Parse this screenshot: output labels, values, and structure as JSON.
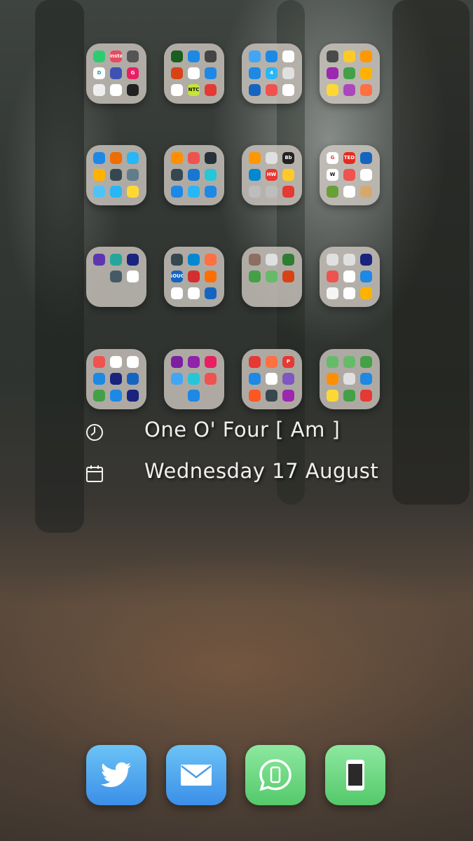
{
  "widgets": {
    "time_text": "One O' Four [ Am ]",
    "date_text": "Wednesday 17 August",
    "time_icon": "clock-icon",
    "date_icon": "calendar-icon"
  },
  "folders": [
    {
      "name": "folder-1",
      "apps": [
        {
          "label": "",
          "color": "#2ecc71"
        },
        {
          "label": "insta",
          "color": "#e84a5f"
        },
        {
          "label": "",
          "color": "#555555"
        },
        {
          "label": "D",
          "color": "#ffffff",
          "text": "#16a085"
        },
        {
          "label": "",
          "color": "#3f51b5"
        },
        {
          "label": "G",
          "color": "#e91e63"
        },
        {
          "label": "",
          "color": "#eeeeee"
        },
        {
          "label": "",
          "color": "#ffffff"
        },
        {
          "label": "",
          "color": "#222222"
        }
      ]
    },
    {
      "name": "folder-2",
      "apps": [
        {
          "label": "",
          "color": "#1b5e20"
        },
        {
          "label": "",
          "color": "#1e88e5"
        },
        {
          "label": "",
          "color": "#444444"
        },
        {
          "label": "",
          "color": "#d84315"
        },
        {
          "label": "",
          "color": "#ffffff"
        },
        {
          "label": "",
          "color": "#1e88e5"
        },
        {
          "label": "",
          "color": "#ffffff"
        },
        {
          "label": "NTC",
          "color": "#c6e43a",
          "text": "#111111"
        },
        {
          "label": "",
          "color": "#e53935"
        }
      ]
    },
    {
      "name": "folder-3",
      "apps": [
        {
          "label": "",
          "color": "#42a5f5"
        },
        {
          "label": "",
          "color": "#1e88e5"
        },
        {
          "label": "",
          "color": "#ffffff"
        },
        {
          "label": "",
          "color": "#1e88e5"
        },
        {
          "label": "4",
          "color": "#29b6f6"
        },
        {
          "label": "",
          "color": "#e0e0e0"
        },
        {
          "label": "",
          "color": "#1565c0"
        },
        {
          "label": "",
          "color": "#ef5350"
        },
        {
          "label": "",
          "color": "#ffffff"
        }
      ]
    },
    {
      "name": "folder-4",
      "apps": [
        {
          "label": "",
          "color": "#4a4a4a"
        },
        {
          "label": "",
          "color": "#ffca28"
        },
        {
          "label": "",
          "color": "#ff9800"
        },
        {
          "label": "",
          "color": "#9c27b0"
        },
        {
          "label": "",
          "color": "#43a047"
        },
        {
          "label": "",
          "color": "#ffb300"
        },
        {
          "label": "",
          "color": "#fdd835"
        },
        {
          "label": "",
          "color": "#ab47bc"
        },
        {
          "label": "",
          "color": "#ff7043"
        }
      ]
    },
    {
      "name": "folder-5",
      "apps": [
        {
          "label": "",
          "color": "#1e88e5"
        },
        {
          "label": "",
          "color": "#ef6c00"
        },
        {
          "label": "",
          "color": "#29b6f6"
        },
        {
          "label": "",
          "color": "#ffb300"
        },
        {
          "label": "",
          "color": "#37474f"
        },
        {
          "label": "",
          "color": "#607d8b"
        },
        {
          "label": "",
          "color": "#4fc3f7"
        },
        {
          "label": "",
          "color": "#29b6f6"
        },
        {
          "label": "",
          "color": "#fdd835"
        }
      ]
    },
    {
      "name": "folder-6",
      "apps": [
        {
          "label": "",
          "color": "#ff8f00"
        },
        {
          "label": "",
          "color": "#ef5350"
        },
        {
          "label": "",
          "color": "#263238"
        },
        {
          "label": "",
          "color": "#37474f"
        },
        {
          "label": "",
          "color": "#1976d2"
        },
        {
          "label": "",
          "color": "#26c6da"
        },
        {
          "label": "",
          "color": "#1e88e5"
        },
        {
          "label": "",
          "color": "#29b6f6"
        },
        {
          "label": "",
          "color": "#1e88e5"
        }
      ]
    },
    {
      "name": "folder-7",
      "apps": [
        {
          "label": "",
          "color": "#ff9800"
        },
        {
          "label": "",
          "color": "#e0e0e0"
        },
        {
          "label": "Bb",
          "color": "#222222"
        },
        {
          "label": "",
          "color": "#0288d1"
        },
        {
          "label": "HW",
          "color": "#e53935"
        },
        {
          "label": "",
          "color": "#ffca28"
        },
        {
          "label": "",
          "color": "#bdbdbd"
        },
        {
          "label": "",
          "color": "#bdbdbd"
        },
        {
          "label": "",
          "color": "#e53935"
        }
      ]
    },
    {
      "name": "folder-8",
      "apps": [
        {
          "label": "G",
          "color": "#ffffff",
          "text": "#e53935"
        },
        {
          "label": "TED",
          "color": "#e62b1e"
        },
        {
          "label": "",
          "color": "#1565c0"
        },
        {
          "label": "W",
          "color": "#ffffff",
          "text": "#111111"
        },
        {
          "label": "",
          "color": "#ef5350"
        },
        {
          "label": "",
          "color": "#ffffff"
        },
        {
          "label": "",
          "color": "#689f38"
        },
        {
          "label": "",
          "color": "#ffffff"
        },
        {
          "label": "",
          "color": "#d7a86e"
        }
      ]
    },
    {
      "name": "folder-9",
      "apps": [
        {
          "label": "",
          "color": "#5e35b1"
        },
        {
          "label": "",
          "color": "#26a69a"
        },
        {
          "label": "",
          "color": "#1a237e"
        },
        {
          "label": "",
          "color": "rgba(0,0,0,0)"
        },
        {
          "label": "",
          "color": "#455a64"
        },
        {
          "label": "",
          "color": "#ffffff"
        },
        {
          "label": "",
          "color": "rgba(0,0,0,0)"
        },
        {
          "label": "",
          "color": "rgba(0,0,0,0)"
        },
        {
          "label": "",
          "color": "rgba(0,0,0,0)"
        }
      ]
    },
    {
      "name": "folder-10",
      "apps": [
        {
          "label": "",
          "color": "#37474f"
        },
        {
          "label": "",
          "color": "#0288d1"
        },
        {
          "label": "",
          "color": "#ff7043"
        },
        {
          "label": "SOUQ",
          "color": "#1565c0"
        },
        {
          "label": "",
          "color": "#d32f2f"
        },
        {
          "label": "",
          "color": "#ff6f00"
        },
        {
          "label": "",
          "color": "#ffffff"
        },
        {
          "label": "",
          "color": "#ffffff"
        },
        {
          "label": "",
          "color": "#1565c0"
        }
      ]
    },
    {
      "name": "folder-11",
      "apps": [
        {
          "label": "",
          "color": "#8d6e63"
        },
        {
          "label": "",
          "color": "#e0e0e0"
        },
        {
          "label": "",
          "color": "#2e7d32"
        },
        {
          "label": "",
          "color": "#43a047"
        },
        {
          "label": "",
          "color": "#66bb6a"
        },
        {
          "label": "",
          "color": "#d84315"
        },
        {
          "label": "",
          "color": "rgba(0,0,0,0)"
        },
        {
          "label": "",
          "color": "rgba(0,0,0,0)"
        },
        {
          "label": "",
          "color": "rgba(0,0,0,0)"
        }
      ]
    },
    {
      "name": "folder-12",
      "apps": [
        {
          "label": "",
          "color": "#e0e0e0"
        },
        {
          "label": "",
          "color": "#e0e0e0"
        },
        {
          "label": "",
          "color": "#1a237e"
        },
        {
          "label": "",
          "color": "#ef5350"
        },
        {
          "label": "",
          "color": "#ffffff"
        },
        {
          "label": "",
          "color": "#1e88e5"
        },
        {
          "label": "",
          "color": "#f5f5f5"
        },
        {
          "label": "",
          "color": "#ffffff"
        },
        {
          "label": "",
          "color": "#ffb300"
        }
      ]
    },
    {
      "name": "folder-13",
      "apps": [
        {
          "label": "",
          "color": "#ef5350"
        },
        {
          "label": "",
          "color": "#ffffff"
        },
        {
          "label": "",
          "color": "#ffffff"
        },
        {
          "label": "",
          "color": "#1e88e5"
        },
        {
          "label": "",
          "color": "#1a237e"
        },
        {
          "label": "",
          "color": "#1565c0"
        },
        {
          "label": "",
          "color": "#43a047"
        },
        {
          "label": "",
          "color": "#1e88e5"
        },
        {
          "label": "",
          "color": "#1a237e"
        }
      ]
    },
    {
      "name": "folder-14",
      "apps": [
        {
          "label": "",
          "color": "#7b1fa2"
        },
        {
          "label": "",
          "color": "#8e24aa"
        },
        {
          "label": "",
          "color": "#e91e63"
        },
        {
          "label": "",
          "color": "#42a5f5"
        },
        {
          "label": "",
          "color": "#26c6da"
        },
        {
          "label": "",
          "color": "#ef5350"
        },
        {
          "label": "",
          "color": "rgba(0,0,0,0)"
        },
        {
          "label": "",
          "color": "#1e88e5"
        },
        {
          "label": "",
          "color": "rgba(0,0,0,0)"
        }
      ]
    },
    {
      "name": "folder-15",
      "apps": [
        {
          "label": "",
          "color": "#e53935"
        },
        {
          "label": "",
          "color": "#ff7043"
        },
        {
          "label": "P",
          "color": "#e53935"
        },
        {
          "label": "",
          "color": "#1e88e5"
        },
        {
          "label": "",
          "color": "#ffffff"
        },
        {
          "label": "",
          "color": "#7e57c2"
        },
        {
          "label": "",
          "color": "#ff5722"
        },
        {
          "label": "",
          "color": "#37474f"
        },
        {
          "label": "",
          "color": "#9c27b0"
        }
      ]
    },
    {
      "name": "folder-16",
      "apps": [
        {
          "label": "",
          "color": "#66bb6a"
        },
        {
          "label": "",
          "color": "#66bb6a"
        },
        {
          "label": "",
          "color": "#43a047"
        },
        {
          "label": "",
          "color": "#ff8f00"
        },
        {
          "label": "",
          "color": "#e0e0e0"
        },
        {
          "label": "",
          "color": "#1e88e5"
        },
        {
          "label": "",
          "color": "#fdd835"
        },
        {
          "label": "",
          "color": "#43a047"
        },
        {
          "label": "",
          "color": "#e53935"
        }
      ]
    }
  ],
  "dock": [
    {
      "name": "twitter",
      "icon": "twitter-bird-icon",
      "color_top": "#6cc3f5",
      "color_bottom": "#3b8fe8"
    },
    {
      "name": "mail",
      "icon": "envelope-icon",
      "color_top": "#6cc3f5",
      "color_bottom": "#3b8fe8"
    },
    {
      "name": "whatsapp",
      "icon": "chat-bubble-phone-icon",
      "color_top": "#8de8a0",
      "color_bottom": "#54c96a"
    },
    {
      "name": "phone",
      "icon": "phone-device-icon",
      "color_top": "#8de8a0",
      "color_bottom": "#54c96a"
    }
  ]
}
